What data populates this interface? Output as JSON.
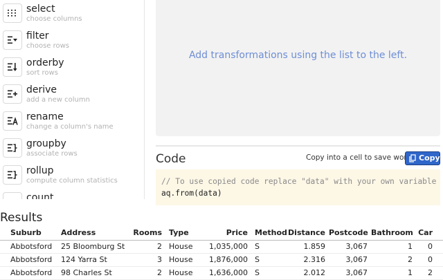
{
  "operations": [
    {
      "name": "select",
      "desc": "choose columns",
      "icon": "select-columns-icon"
    },
    {
      "name": "filter",
      "desc": "choose rows",
      "icon": "filter-icon"
    },
    {
      "name": "orderby",
      "desc": "sort rows",
      "icon": "sort-icon"
    },
    {
      "name": "derive",
      "desc": "add a new column",
      "icon": "derive-icon"
    },
    {
      "name": "rename",
      "desc": "change a column's name",
      "icon": "rename-icon"
    },
    {
      "name": "groupby",
      "desc": "associate rows",
      "icon": "groupby-icon"
    },
    {
      "name": "rollup",
      "desc": "compute column statistics",
      "icon": "rollup-icon"
    },
    {
      "name": "count",
      "desc": "",
      "icon": "count-icon"
    }
  ],
  "transform": {
    "placeholder": "Add transformations using the list to the left."
  },
  "code": {
    "title": "Code",
    "copy_hint": "Copy into a cell to save work",
    "copy_label": "Copy",
    "comment": "// To use copied code replace \"data\" with your own variable",
    "line": "aq.from(data)"
  },
  "results": {
    "title": "Results",
    "columns": [
      "Suburb",
      "Address",
      "Rooms",
      "Type",
      "Price",
      "Method",
      "Distance",
      "Postcode",
      "Bathroom",
      "Car"
    ],
    "rows": [
      [
        "Abbotsford",
        "25 Bloomburg St",
        "2",
        "House",
        "1,035,000",
        "S",
        "1.859",
        "3,067",
        "1",
        "0"
      ],
      [
        "Abbotsford",
        "124 Yarra St",
        "3",
        "House",
        "1,876,000",
        "S",
        "2.316",
        "3,067",
        "2",
        "0"
      ],
      [
        "Abbotsford",
        "98 Charles St",
        "2",
        "House",
        "1,636,000",
        "S",
        "2.012",
        "3,067",
        "1",
        "2"
      ]
    ]
  },
  "colors": {
    "accent": "#2f66c9",
    "placeholder_text": "#6e8ed4",
    "code_bg": "#fdf7e6"
  }
}
